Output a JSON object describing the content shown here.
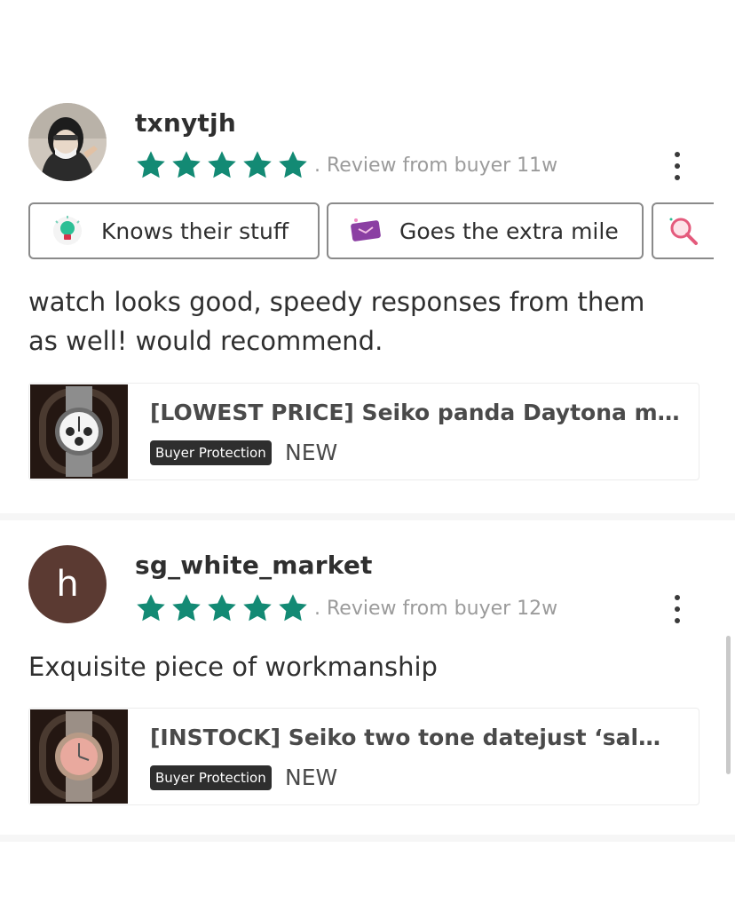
{
  "colors": {
    "star_green": "#138a74",
    "badge_bg": "#2e2e2e",
    "avatar_letter_bg": "#5b3a32"
  },
  "reviews": [
    {
      "username": "txnytjh",
      "avatar": "photo",
      "rating": 5,
      "meta": ". Review from buyer 11w",
      "tags": [
        {
          "icon": "lightbulb-icon",
          "label": "Knows their stuff"
        },
        {
          "icon": "gift-card-icon",
          "label": "Goes the extra mile"
        },
        {
          "icon": "magnifier-icon",
          "label": ""
        }
      ],
      "text_lines": [
        "watch looks good, speedy responses from them",
        "as well! would recommend."
      ],
      "listing": {
        "title": "[LOWEST PRICE] Seiko panda Daytona m...",
        "badge": "Buyer Protection",
        "condition": "NEW"
      }
    },
    {
      "username": "sg_white_market",
      "avatar_letter": "h",
      "rating": 5,
      "meta": ". Review from buyer 12w",
      "text": "Exquisite piece of workmanship",
      "listing": {
        "title": "[INSTOCK] Seiko two tone datejust ‘salm...",
        "badge": "Buyer Protection",
        "condition": "NEW"
      }
    }
  ]
}
